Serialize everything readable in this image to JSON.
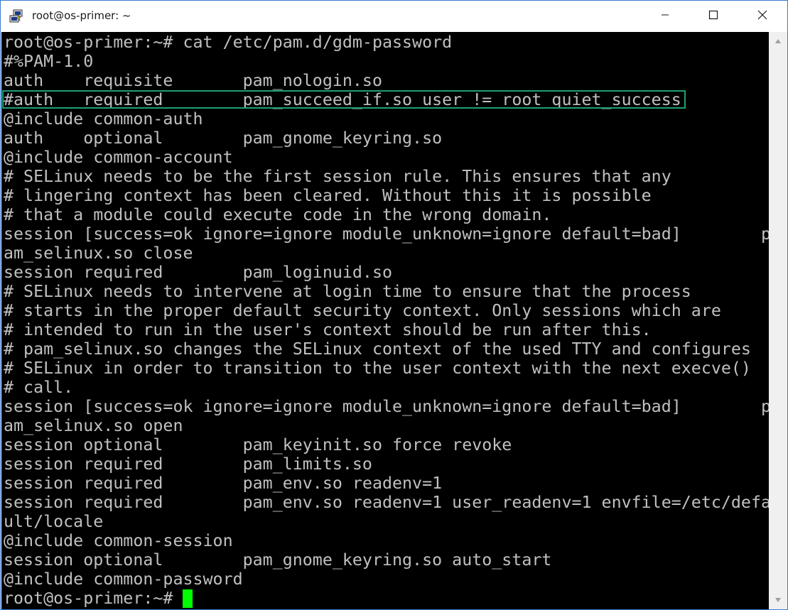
{
  "window": {
    "title": "root@os-primer: ~",
    "app_icon": "putty-icon",
    "controls": {
      "minimize": "minimize-icon",
      "maximize": "maximize-icon",
      "close": "close-icon"
    }
  },
  "terminal": {
    "lines": [
      "root@os-primer:~# cat /etc/pam.d/gdm-password",
      "#%PAM-1.0",
      "auth    requisite       pam_nologin.so",
      "#auth   required        pam_succeed_if.so user != root quiet_success",
      "@include common-auth",
      "auth    optional        pam_gnome_keyring.so",
      "@include common-account",
      "# SELinux needs to be the first session rule. This ensures that any",
      "# lingering context has been cleared. Without this it is possible",
      "# that a module could execute code in the wrong domain.",
      "session [success=ok ignore=ignore module_unknown=ignore default=bad]        p",
      "am_selinux.so close",
      "session required        pam_loginuid.so",
      "# SELinux needs to intervene at login time to ensure that the process",
      "# starts in the proper default security context. Only sessions which are",
      "# intended to run in the user's context should be run after this.",
      "# pam_selinux.so changes the SELinux context of the used TTY and configures",
      "# SELinux in order to transition to the user context with the next execve()",
      "# call.",
      "session [success=ok ignore=ignore module_unknown=ignore default=bad]        p",
      "am_selinux.so open",
      "session optional        pam_keyinit.so force revoke",
      "session required        pam_limits.so",
      "session required        pam_env.so readenv=1",
      "session required        pam_env.so readenv=1 user_readenv=1 envfile=/etc/defa",
      "ult/locale",
      "@include common-session",
      "session optional        pam_gnome_keyring.so auto_start",
      "@include common-password"
    ],
    "prompt": "root@os-primer:~# ",
    "highlight_color": "#1f9e78",
    "cursor_color": "#00ff00",
    "text_color": "#c0c0c0",
    "background_color": "#000000"
  }
}
